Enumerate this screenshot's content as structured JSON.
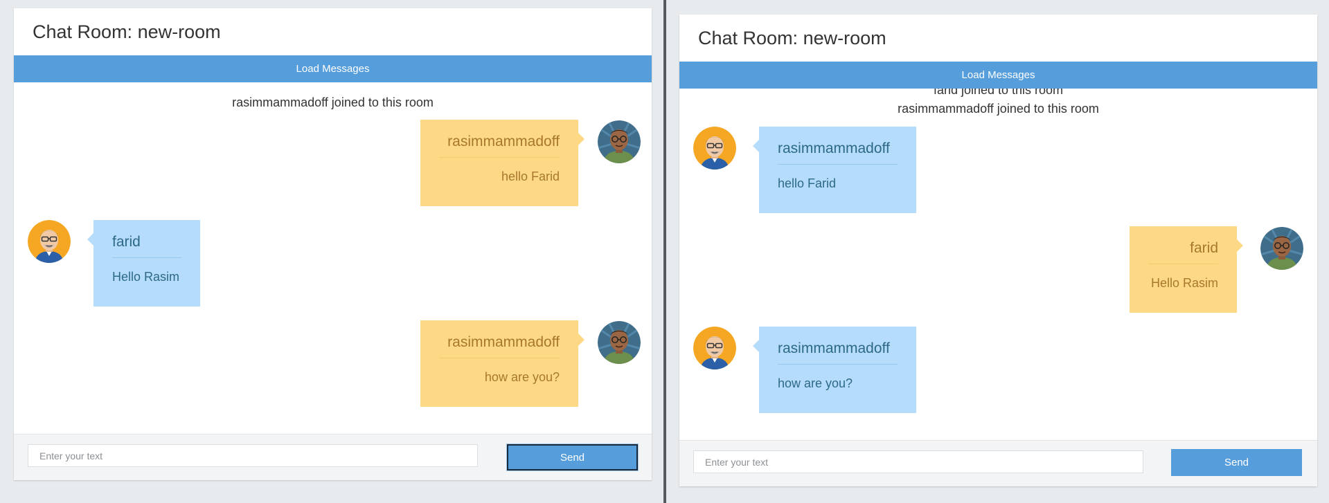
{
  "left_panel": {
    "header": {
      "title_label": "Chat Room: ",
      "room_name": "new-room"
    },
    "load_button": "Load Messages",
    "system_messages": [
      "rasimmammadoff joined to this room"
    ],
    "messages": [
      {
        "user": "rasimmammadoff",
        "text": "hello Farid",
        "avatar": "dark-hair-man-avatar",
        "color": "yellow"
      },
      {
        "user": "farid",
        "text": "Hello Rasim",
        "avatar": "gray-hair-man-avatar",
        "color": "blue"
      },
      {
        "user": "rasimmammadoff",
        "text": "how are you?",
        "avatar": "dark-hair-man-avatar",
        "color": "yellow"
      }
    ],
    "composer": {
      "placeholder": "Enter your text",
      "send_label": "Send"
    }
  },
  "right_panel": {
    "header": {
      "title_label": "Chat Room: ",
      "room_name": "new-room"
    },
    "load_button": "Load Messages",
    "system_messages": [
      "farid joined to this room",
      "rasimmammadoff joined to this room"
    ],
    "messages": [
      {
        "user": "rasimmammadoff",
        "text": "hello Farid",
        "avatar": "gray-hair-man-avatar",
        "color": "blue"
      },
      {
        "user": "farid",
        "text": "Hello Rasim",
        "avatar": "dark-hair-man-avatar",
        "color": "yellow"
      },
      {
        "user": "rasimmammadoff",
        "text": "how are you?",
        "avatar": "gray-hair-man-avatar",
        "color": "blue"
      }
    ],
    "composer": {
      "placeholder": "Enter your text",
      "send_label": "Send"
    }
  },
  "colors": {
    "accent_blue": "#569ddb",
    "bubble_yellow": "#fdd985",
    "bubble_blue": "#b5dcfb",
    "page_background": "#e8ebee"
  }
}
